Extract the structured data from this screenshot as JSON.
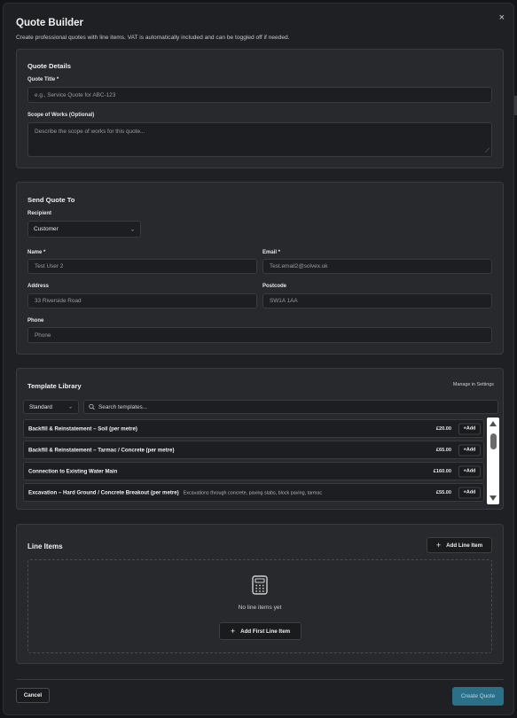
{
  "modal": {
    "title": "Quote Builder",
    "subtitle": "Create professional quotes with line items. VAT is automatically included and can be toggled off if needed.",
    "close_label": "×"
  },
  "quote_details": {
    "heading": "Quote Details",
    "title_label": "Quote Title *",
    "title_placeholder": "e.g., Service Quote for ABC-123",
    "scope_label": "Scope of Works (Optional)",
    "scope_placeholder": "Describe the scope of works for this quote..."
  },
  "send_to": {
    "heading": "Send Quote To",
    "recipient_label": "Recipient",
    "recipient_value": "Customer",
    "name_label": "Name *",
    "name_value": "Test User 2",
    "email_label": "Email *",
    "email_value": "Test.email2@solvex.uk",
    "address_label": "Address",
    "address_value": "33 Riverside Road",
    "postcode_label": "Postcode",
    "postcode_value": "SW1A 1AA",
    "phone_label": "Phone",
    "phone_placeholder": "Phone"
  },
  "template_library": {
    "heading": "Template Library",
    "manage_link": "Manage in Settings",
    "category_value": "Standard",
    "search_placeholder": "Search templates...",
    "add_label": "+Add",
    "items": [
      {
        "name": "Backfill & Reinstatement – Soil (per metre)",
        "description": "",
        "price": "£20.00"
      },
      {
        "name": "Backfill & Reinstatement – Tarmac / Concrete (per metre)",
        "description": "",
        "price": "£65.00"
      },
      {
        "name": "Connection to Existing Water Main",
        "description": "",
        "price": "£160.00"
      },
      {
        "name": "Excavation – Hard Ground / Concrete Breakout (per metre)",
        "description": "Excavations through concrete, paving slabs, block paving, tarmac",
        "price": "£55.00"
      }
    ]
  },
  "line_items": {
    "heading": "Line Items",
    "add_button": "Add Line Item",
    "empty_text": "No line items yet",
    "add_first_button": "Add First Line Item"
  },
  "footer": {
    "cancel": "Cancel",
    "create": "Create Quote"
  },
  "colors": {
    "background": "#1f2023",
    "card": "#28292c",
    "primary_button": "#2b7089"
  }
}
